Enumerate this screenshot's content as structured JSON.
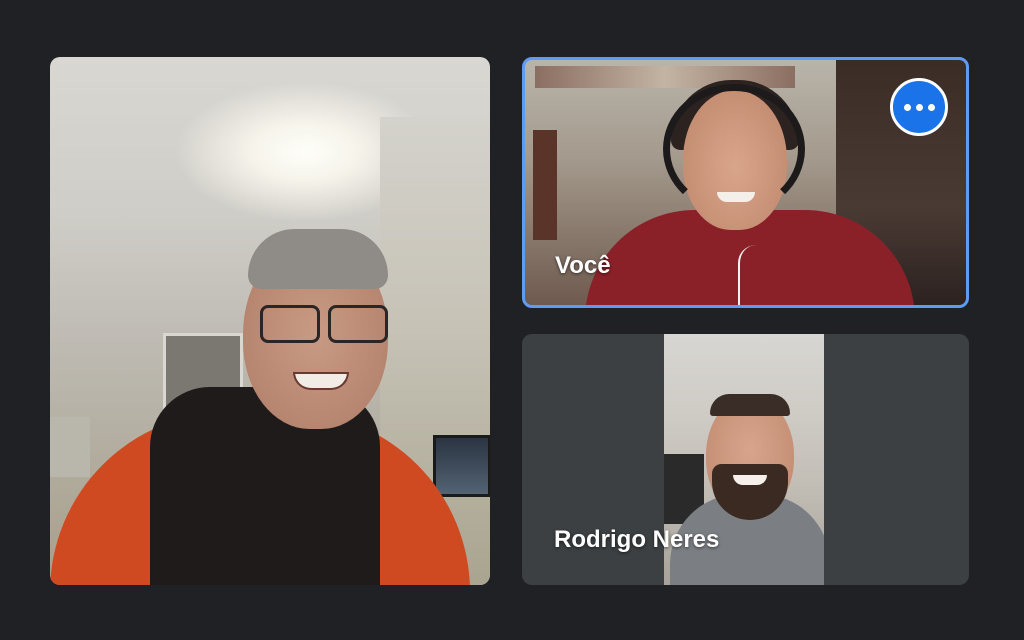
{
  "meeting": {
    "participants": [
      {
        "name": "",
        "tile": "main"
      },
      {
        "name": "Você",
        "tile": "self",
        "active_speaker": true
      },
      {
        "name": "Rodrigo Neres",
        "tile": "secondary"
      }
    ]
  },
  "self_tile": {
    "label": "Você",
    "menu_icon": "more-horizontal-icon"
  },
  "rodrigo_tile": {
    "label": "Rodrigo Neres"
  },
  "colors": {
    "background": "#202124",
    "tile_background": "#3c4043",
    "active_border": "#5e9bf4",
    "menu_button": "#1a73e8"
  }
}
